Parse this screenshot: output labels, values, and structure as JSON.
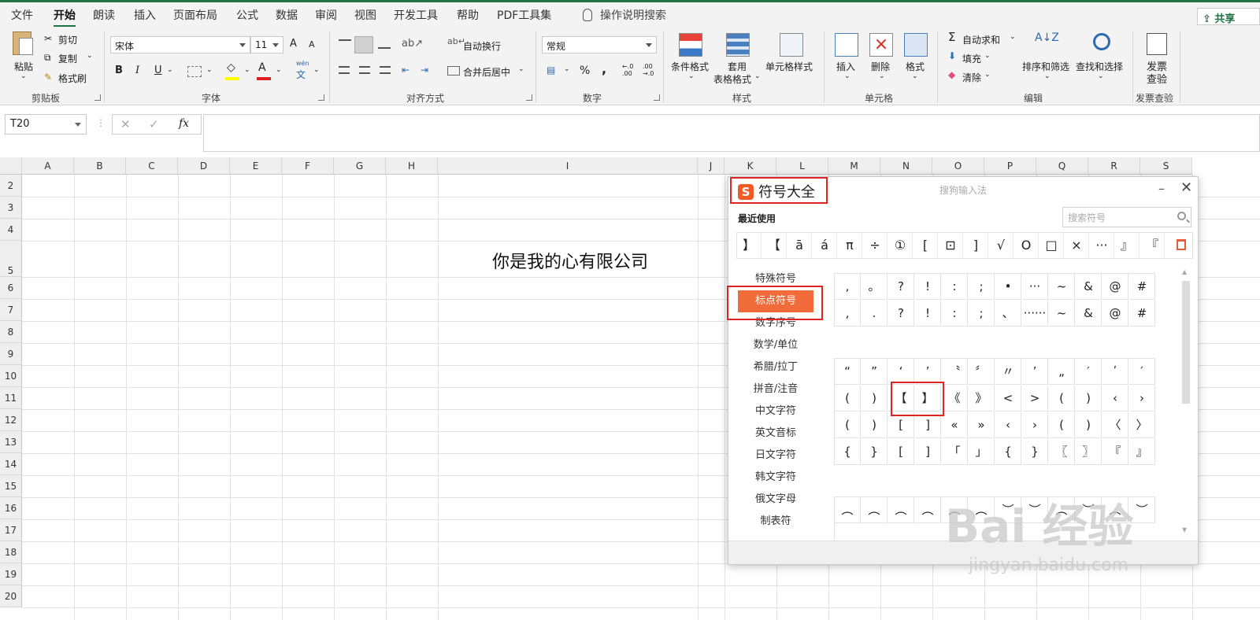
{
  "tabs": [
    "文件",
    "开始",
    "朗读",
    "插入",
    "页面布局",
    "公式",
    "数据",
    "审阅",
    "视图",
    "开发工具",
    "帮助",
    "PDF工具集"
  ],
  "active_tab": "开始",
  "tell_me": "操作说明搜索",
  "share": "共享",
  "clipboard": {
    "paste": "粘贴",
    "cut": "剪切",
    "copy": "复制",
    "format_painter": "格式刷",
    "label": "剪贴板"
  },
  "font": {
    "name": "宋体",
    "size": "11",
    "grow": "A",
    "shrink": "A",
    "bold": "B",
    "italic": "I",
    "underline": "U",
    "phonetic": "文",
    "phonetic_top": "wén",
    "label": "字体"
  },
  "alignment": {
    "wrap": "自动换行",
    "merge": "合并后居中",
    "label": "对齐方式"
  },
  "number": {
    "format": "常规",
    "percent": "%",
    "comma": ",",
    "inc": ".00\n←.0",
    "label": "数字"
  },
  "styles": {
    "conditional": "条件格式",
    "table": "套用",
    "table2": "表格格式",
    "cell": "单元格样式",
    "label": "样式"
  },
  "cells": {
    "insert": "插入",
    "delete": "删除",
    "format": "格式",
    "label": "单元格"
  },
  "editing": {
    "autosum": "自动求和",
    "fill": "填充",
    "clear": "清除",
    "sort": "排序和筛选",
    "find": "查找和选择",
    "label": "编辑"
  },
  "invoice": {
    "check1": "发票",
    "check2": "查验",
    "label": "发票查验"
  },
  "formula_bar": {
    "name_box": "T20",
    "fx": "fx"
  },
  "columns": [
    "A",
    "B",
    "C",
    "D",
    "E",
    "F",
    "G",
    "H",
    "I",
    "J",
    "K",
    "L",
    "M",
    "N",
    "O",
    "P",
    "Q",
    "R",
    "S"
  ],
  "rows": [
    "2",
    "3",
    "4",
    "5",
    "6",
    "7",
    "8",
    "9",
    "10",
    "11",
    "12",
    "13",
    "14",
    "15",
    "16",
    "17",
    "18",
    "19",
    "20"
  ],
  "cell_text": "你是我的心有限公司",
  "dialog": {
    "title": "符号大全",
    "logo": "S",
    "ime": "搜狗输入法",
    "minimize": "–",
    "close": "✕",
    "recent_label": "最近使用",
    "search_placeholder": "搜索符号",
    "recent": [
      "】",
      "【",
      "ā",
      "á",
      "π",
      "÷",
      "①",
      "[",
      "⊡",
      "]",
      "√",
      "O",
      "□",
      "×",
      "···",
      "』",
      "『"
    ],
    "categories": [
      "特殊符号",
      "标点符号",
      "数字序号",
      "数学/单位",
      "希腊/拉丁",
      "拼音/注音",
      "中文字符",
      "英文音标",
      "日文字符",
      "韩文字符",
      "俄文字母",
      "制表符"
    ],
    "active_category": "标点符号",
    "grid1": [
      [
        ",",
        "。",
        "?",
        "!",
        ":",
        ";",
        "•",
        "···",
        "~",
        "&",
        "@",
        "#"
      ],
      [
        ",",
        ".",
        "?",
        "!",
        ":",
        ";",
        "、",
        "······",
        "~",
        "&",
        "@",
        "#"
      ]
    ],
    "grid2": [
      [
        "“",
        "”",
        "‘",
        "’",
        "〝",
        "〞",
        "〃",
        "’",
        "„",
        "′",
        "ʹ",
        "′"
      ],
      [
        "(",
        ")",
        "【",
        "】",
        "《",
        "》",
        "<",
        ">",
        "(",
        ")",
        "‹",
        "›"
      ],
      [
        "(",
        ")",
        "[",
        "]",
        "«",
        "»",
        "‹",
        "›",
        "(",
        ")",
        "〈",
        "〉"
      ],
      [
        "{",
        "}",
        "[",
        "]",
        "「",
        "」",
        "{",
        "}",
        "〖",
        "〗",
        "『",
        "』"
      ]
    ],
    "grid3": [
      [
        "︵",
        "︵",
        "︵",
        "︵",
        "︵",
        "︵",
        "︶",
        "︶",
        "︵",
        "︶",
        "︵",
        "︶"
      ]
    ]
  },
  "watermark": {
    "main": "Bai 经验",
    "sub": "jingyan.baidu.com"
  }
}
